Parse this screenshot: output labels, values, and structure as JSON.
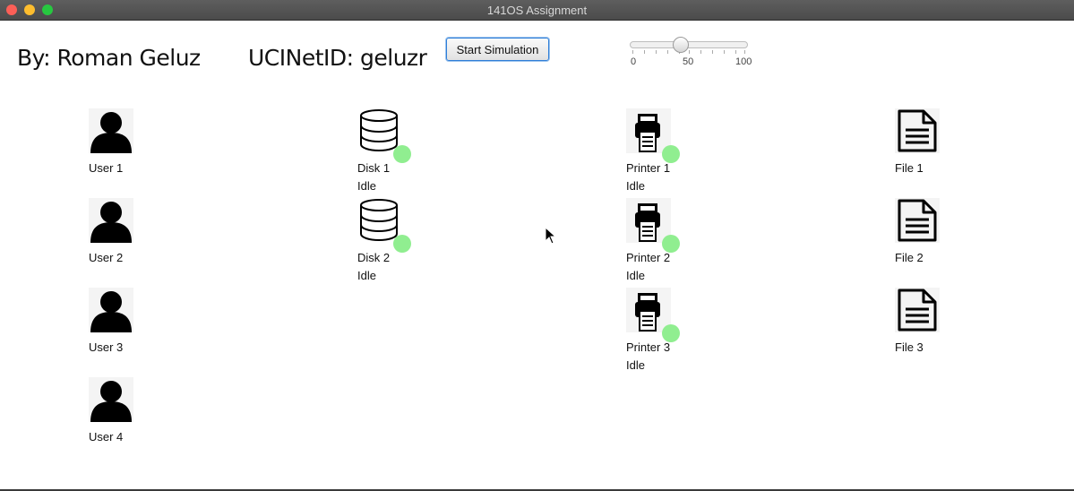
{
  "window": {
    "title": "141OS Assignment"
  },
  "header": {
    "author": "By: Roman Geluz",
    "ucinetid": "UCINetID: geluzr"
  },
  "controls": {
    "start_button": "Start Simulation",
    "slider": {
      "value": 40,
      "min": 0,
      "max": 100,
      "labels": [
        "0",
        "50",
        "100"
      ]
    }
  },
  "users": [
    {
      "label": "User 1"
    },
    {
      "label": "User 2"
    },
    {
      "label": "User 3"
    },
    {
      "label": "User 4"
    }
  ],
  "disks": [
    {
      "label": "Disk 1",
      "status": "Idle"
    },
    {
      "label": "Disk 2",
      "status": "Idle"
    }
  ],
  "printers": [
    {
      "label": "Printer 1",
      "status": "Idle"
    },
    {
      "label": "Printer 2",
      "status": "Idle"
    },
    {
      "label": "Printer 3",
      "status": "Idle"
    }
  ],
  "files": [
    {
      "label": "File 1"
    },
    {
      "label": "File 2"
    },
    {
      "label": "File 3"
    }
  ],
  "colors": {
    "idle_indicator": "#90ee90",
    "button_focus": "#2f7ed8"
  },
  "icons": {
    "user": "user-icon",
    "disk": "database-icon",
    "printer": "printer-icon",
    "file": "document-icon"
  }
}
